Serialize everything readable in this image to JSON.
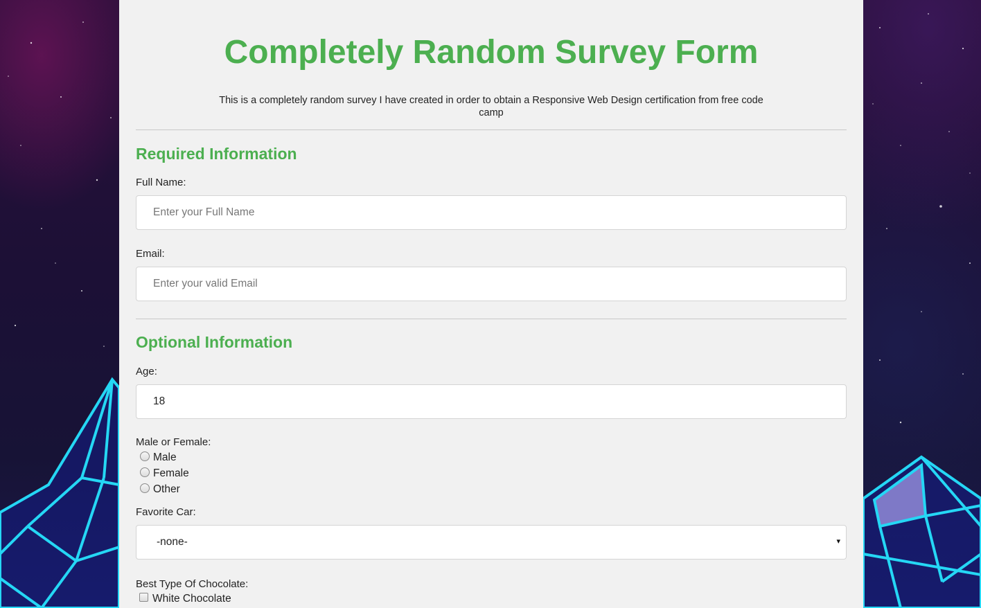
{
  "title": "Completely Random Survey Form",
  "description": "This is a completely random survey I have created in order to obtain a Responsive Web Design certification from free code camp",
  "required_section": {
    "heading": "Required Information",
    "name_label": "Full Name:",
    "name_placeholder": "Enter your Full Name",
    "email_label": "Email:",
    "email_placeholder": "Enter your valid Email"
  },
  "optional_section": {
    "heading": "Optional Information",
    "age_label": "Age:",
    "age_value": "18",
    "gender_label": "Male or Female:",
    "gender_options": [
      "Male",
      "Female",
      "Other"
    ],
    "car_label": "Favorite Car:",
    "car_value": "-none-",
    "car_arrow": "▾",
    "chocolate_label": "Best Type Of Chocolate:",
    "chocolate_options": [
      "White Chocolate"
    ]
  },
  "colors": {
    "accent": "#4caf50",
    "panel": "#f1f1f1"
  }
}
